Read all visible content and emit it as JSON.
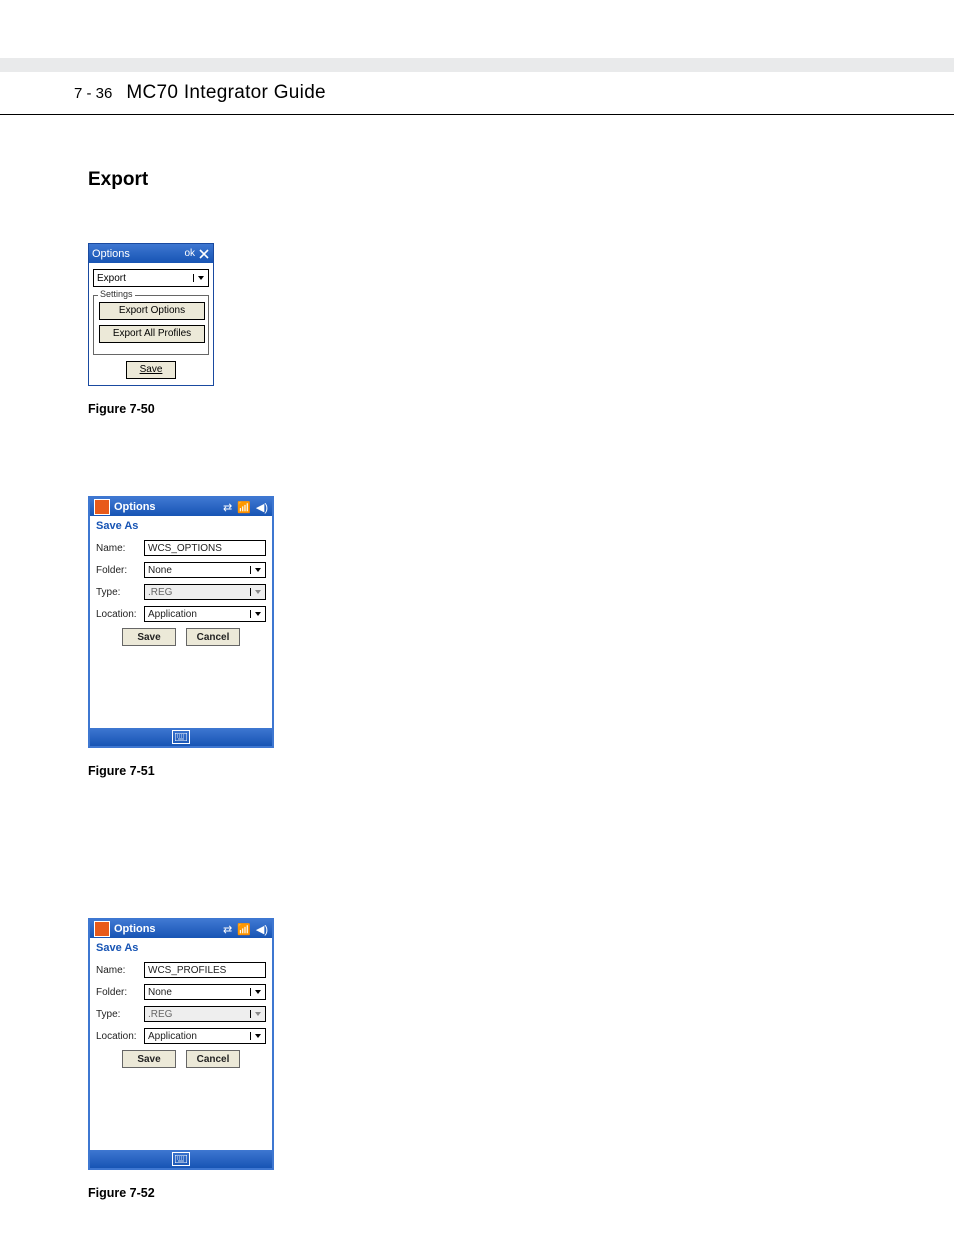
{
  "header": {
    "page_number": "7 - 36",
    "guide_title": "MC70 Integrator Guide"
  },
  "section_title": "Export",
  "fig50": {
    "caption": "Figure 7-50",
    "window_title": "Options",
    "ok_label": "ok",
    "dropdown_value": "Export",
    "fieldset_legend": "Settings",
    "btn_export_options": "Export Options",
    "btn_export_all_profiles": "Export All Profiles",
    "btn_save": "Save"
  },
  "fig51": {
    "caption": "Figure 7-51",
    "window_title": "Options",
    "sub_header": "Save As",
    "labels": {
      "name": "Name:",
      "folder": "Folder:",
      "type": "Type:",
      "location": "Location:"
    },
    "name_value": "WCS_OPTIONS",
    "folder_value": "None",
    "type_value": ".REG",
    "location_value": "Application",
    "btn_save": "Save",
    "btn_cancel": "Cancel"
  },
  "fig52": {
    "caption": "Figure 7-52",
    "window_title": "Options",
    "sub_header": "Save As",
    "labels": {
      "name": "Name:",
      "folder": "Folder:",
      "type": "Type:",
      "location": "Location:"
    },
    "name_value": "WCS_PROFILES",
    "folder_value": "None",
    "type_value": ".REG",
    "location_value": "Application",
    "btn_save": "Save",
    "btn_cancel": "Cancel"
  }
}
